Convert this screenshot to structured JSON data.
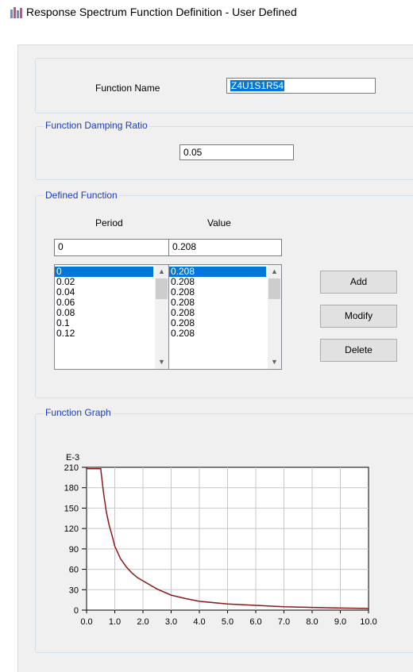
{
  "window": {
    "title": "Response Spectrum Function Definition - User Defined",
    "icon": "etabs-app-icon"
  },
  "function_name": {
    "label": "Function Name",
    "value": "Z4U1S1R54"
  },
  "damping": {
    "group_title": "Function Damping Ratio",
    "value": "0.05"
  },
  "defined_function": {
    "group_title": "Defined Function",
    "period_header": "Period",
    "value_header": "Value",
    "period_input": "0",
    "value_input": "0.208",
    "periods": [
      "0",
      "0.02",
      "0.04",
      "0.06",
      "0.08",
      "0.1",
      "0.12"
    ],
    "values": [
      "0.208",
      "0.208",
      "0.208",
      "0.208",
      "0.208",
      "0.208",
      "0.208"
    ],
    "buttons": {
      "add": "Add",
      "modify": "Modify",
      "delete": "Delete"
    }
  },
  "graph": {
    "group_title": "Function Graph"
  },
  "chart_data": {
    "type": "line",
    "title": "",
    "xlabel": "",
    "ylabel": "",
    "y_multiplier_label": "E-3",
    "xlim": [
      0,
      10
    ],
    "ylim": [
      0,
      210
    ],
    "x_ticks": [
      "0.0",
      "1.0",
      "2.0",
      "3.0",
      "4.0",
      "5.0",
      "6.0",
      "7.0",
      "8.0",
      "9.0",
      "10.0"
    ],
    "y_ticks": [
      "0",
      "30",
      "60",
      "90",
      "120",
      "150",
      "180",
      "210"
    ],
    "grid": true,
    "line_color": "#8b1a1a",
    "series": [
      {
        "x": [
          0,
          0.5,
          0.6,
          0.7,
          0.8,
          0.9,
          1.0,
          1.2,
          1.4,
          1.6,
          1.8,
          2.0,
          2.5,
          3.0,
          3.5,
          4.0,
          5.0,
          6.0,
          7.0,
          8.0,
          9.0,
          10.0
        ],
        "values": [
          208,
          208,
          173,
          145,
          125,
          110,
          94,
          76,
          64,
          55,
          48,
          43,
          31,
          22,
          17,
          13,
          9,
          7,
          5,
          4,
          3,
          2.5
        ]
      }
    ]
  }
}
